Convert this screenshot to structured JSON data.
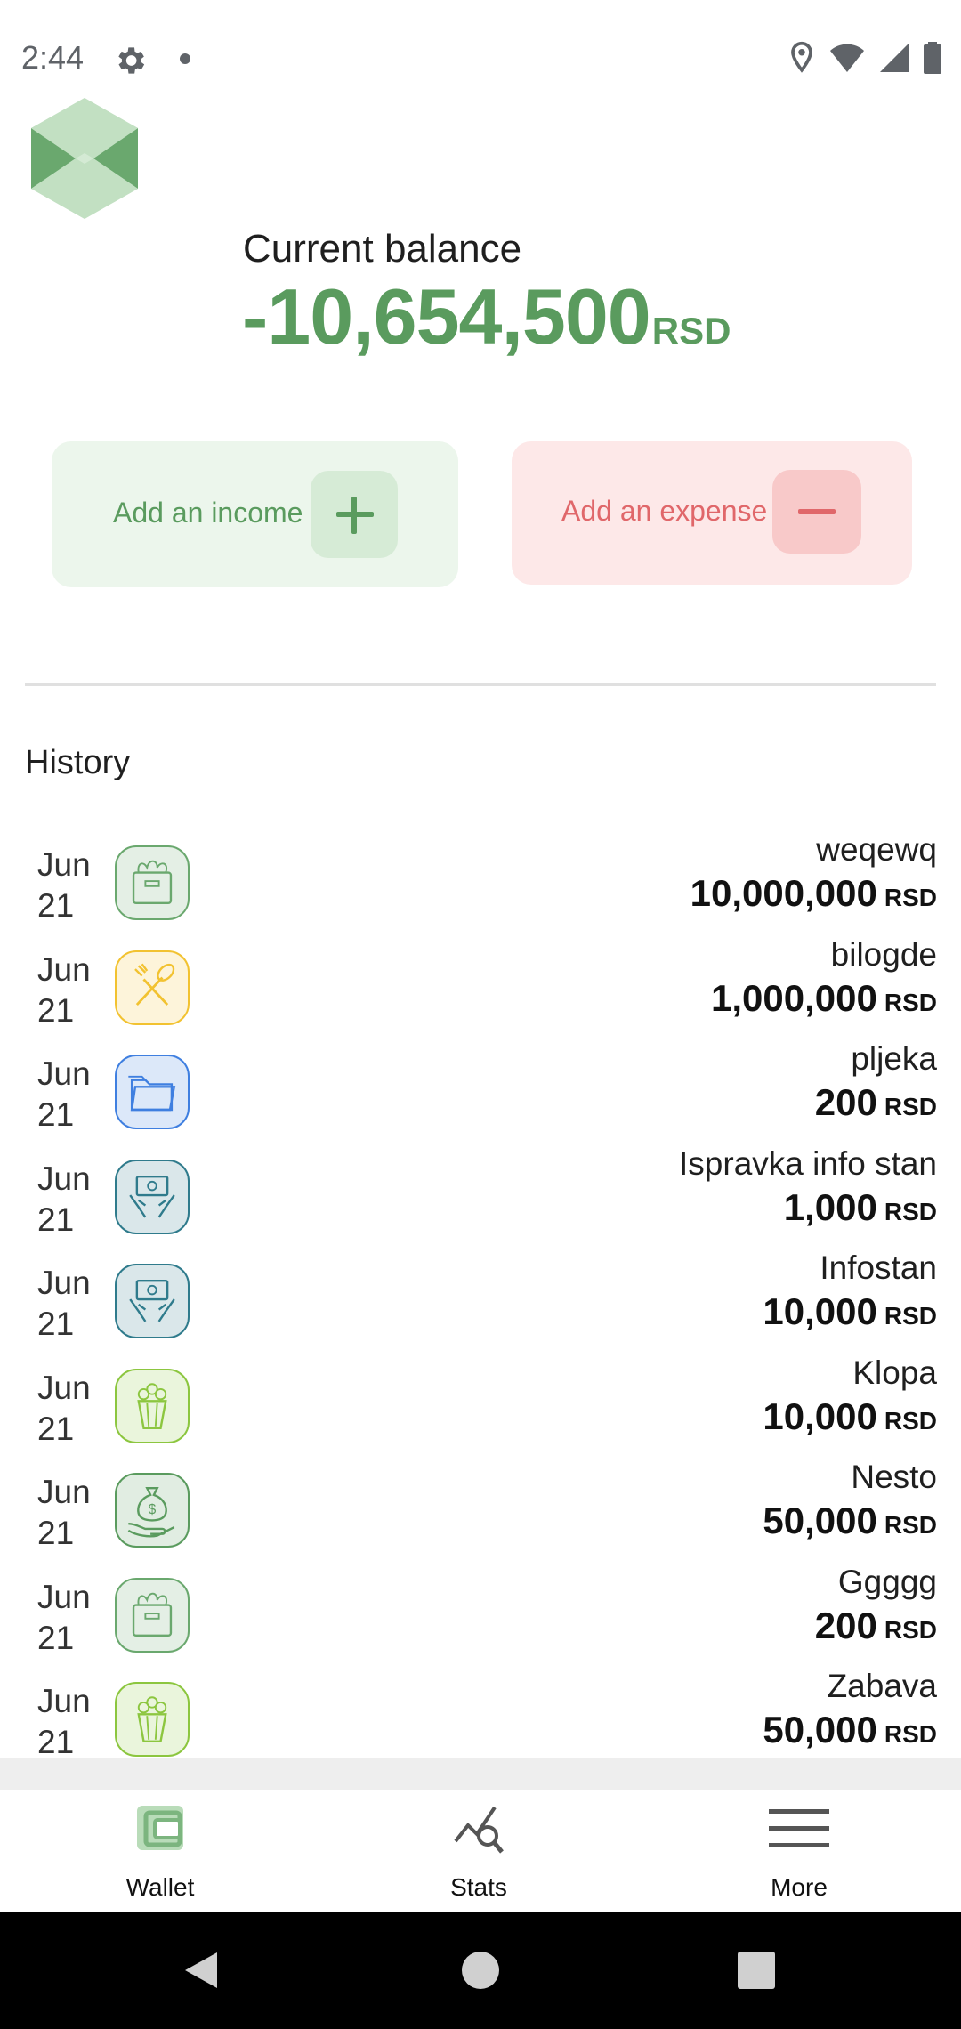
{
  "status_bar": {
    "time": "2:44",
    "icons": [
      "gear-icon",
      "notification-dot",
      "location-icon",
      "wifi-icon",
      "signal-icon",
      "battery-icon"
    ]
  },
  "balance": {
    "label": "Current balance",
    "value": "-10,654,500",
    "currency": "RSD",
    "color": "#5a9b5e"
  },
  "actions": {
    "income_label": "Add an income",
    "expense_label": "Add an expense",
    "income_color": "#5a9b5e",
    "expense_color": "#e0676a"
  },
  "history": {
    "title": "History",
    "items": [
      {
        "month": "Jun",
        "day": "21",
        "name": "weqewq",
        "amount": "10,000,000",
        "currency": "RSD",
        "icon": "grocery-bag-icon",
        "icon_color": "#6aa86e"
      },
      {
        "month": "Jun",
        "day": "21",
        "name": "bilogde",
        "amount": "1,000,000",
        "currency": "RSD",
        "icon": "fork-spoon-icon",
        "icon_color": "#f2c230"
      },
      {
        "month": "Jun",
        "day": "21",
        "name": "pljeka",
        "amount": "200",
        "currency": "RSD",
        "icon": "folder-icon",
        "icon_color": "#3f7fe0"
      },
      {
        "month": "Jun",
        "day": "21",
        "name": "Ispravka info stan",
        "amount": "1,000",
        "currency": "RSD",
        "icon": "cash-hands-icon",
        "icon_color": "#2f7b8c"
      },
      {
        "month": "Jun",
        "day": "21",
        "name": "Infostan",
        "amount": "10,000",
        "currency": "RSD",
        "icon": "cash-hands-icon",
        "icon_color": "#2f7b8c"
      },
      {
        "month": "Jun",
        "day": "21",
        "name": "Klopa",
        "amount": "10,000",
        "currency": "RSD",
        "icon": "popcorn-icon",
        "icon_color": "#8cc63f"
      },
      {
        "month": "Jun",
        "day": "21",
        "name": "Nesto",
        "amount": "50,000",
        "currency": "RSD",
        "icon": "money-bag-hand-icon",
        "icon_color": "#5a9b5e"
      },
      {
        "month": "Jun",
        "day": "21",
        "name": "Ggggg",
        "amount": "200",
        "currency": "RSD",
        "icon": "grocery-bag-icon",
        "icon_color": "#6aa86e"
      },
      {
        "month": "Jun",
        "day": "21",
        "name": "Zabava",
        "amount": "50,000",
        "currency": "RSD",
        "icon": "popcorn-icon",
        "icon_color": "#8cc63f"
      }
    ]
  },
  "bottom_nav": {
    "items": [
      {
        "label": "Wallet",
        "icon": "wallet-icon",
        "active": true
      },
      {
        "label": "Stats",
        "icon": "stats-icon",
        "active": false
      },
      {
        "label": "More",
        "icon": "menu-icon",
        "active": false
      }
    ]
  }
}
